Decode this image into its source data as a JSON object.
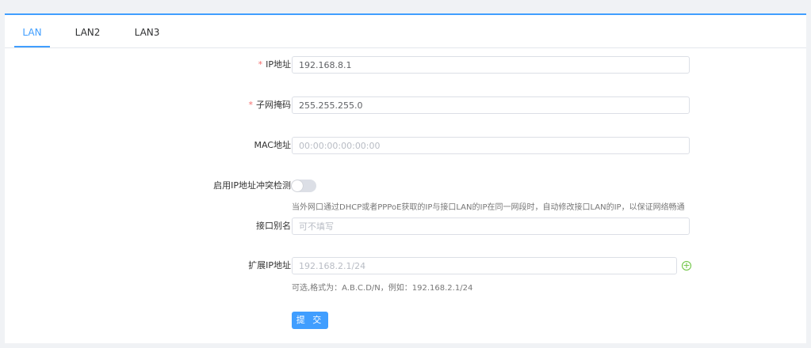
{
  "tabs": [
    {
      "label": "LAN",
      "active": true
    },
    {
      "label": "LAN2",
      "active": false
    },
    {
      "label": "LAN3",
      "active": false
    }
  ],
  "form": {
    "ip": {
      "label": "IP地址",
      "required_mark": "*",
      "value": "192.168.8.1"
    },
    "mask": {
      "label": "子网掩码",
      "required_mark": "*",
      "value": "255.255.255.0"
    },
    "mac": {
      "label": "MAC地址",
      "placeholder": "00:00:00:00:00:00"
    },
    "conflict": {
      "label": "启用IP地址冲突检测",
      "enabled": false,
      "hint": "当外网口通过DHCP或者PPPoE获取的IP与接口LAN的IP在同一网段时，自动修改接口LAN的IP，以保证网络畅通"
    },
    "alias": {
      "label": "接口别名",
      "placeholder": "可不填写"
    },
    "ext_ip": {
      "label": "扩展IP地址",
      "placeholder": "192.168.2.1/24",
      "hint": "可选,格式为：A.B.C.D/N，例如：192.168.2.1/24"
    },
    "submit_label": "提 交"
  },
  "colors": {
    "accent": "#409eff",
    "required": "#f56c6c",
    "add": "#67c23a"
  }
}
